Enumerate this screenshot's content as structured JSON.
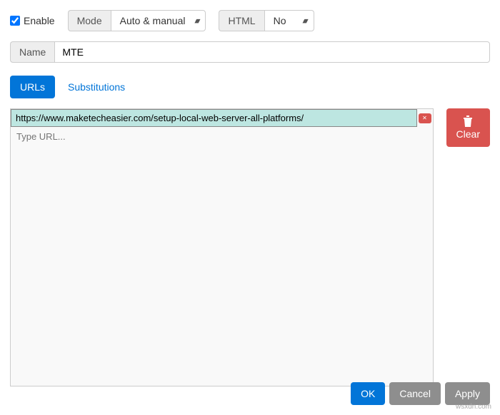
{
  "topRow": {
    "enable": {
      "label": "Enable",
      "checked": true
    },
    "mode": {
      "label": "Mode",
      "value": "Auto & manual"
    },
    "html": {
      "label": "HTML",
      "value": "No"
    }
  },
  "nameRow": {
    "label": "Name",
    "value": "MTE"
  },
  "tabs": {
    "urls": "URLs",
    "substitutions": "Substitutions"
  },
  "urls": {
    "items": [
      {
        "value": "https://www.maketecheasier.com/setup-local-web-server-all-platforms/",
        "selected": true
      }
    ],
    "placeholder": "Type URL...",
    "deleteIcon": "✕"
  },
  "clear": {
    "label": "Clear"
  },
  "footer": {
    "ok": "OK",
    "cancel": "Cancel",
    "apply": "Apply"
  },
  "caret": "▴▾",
  "watermark": "wsxdn.com"
}
